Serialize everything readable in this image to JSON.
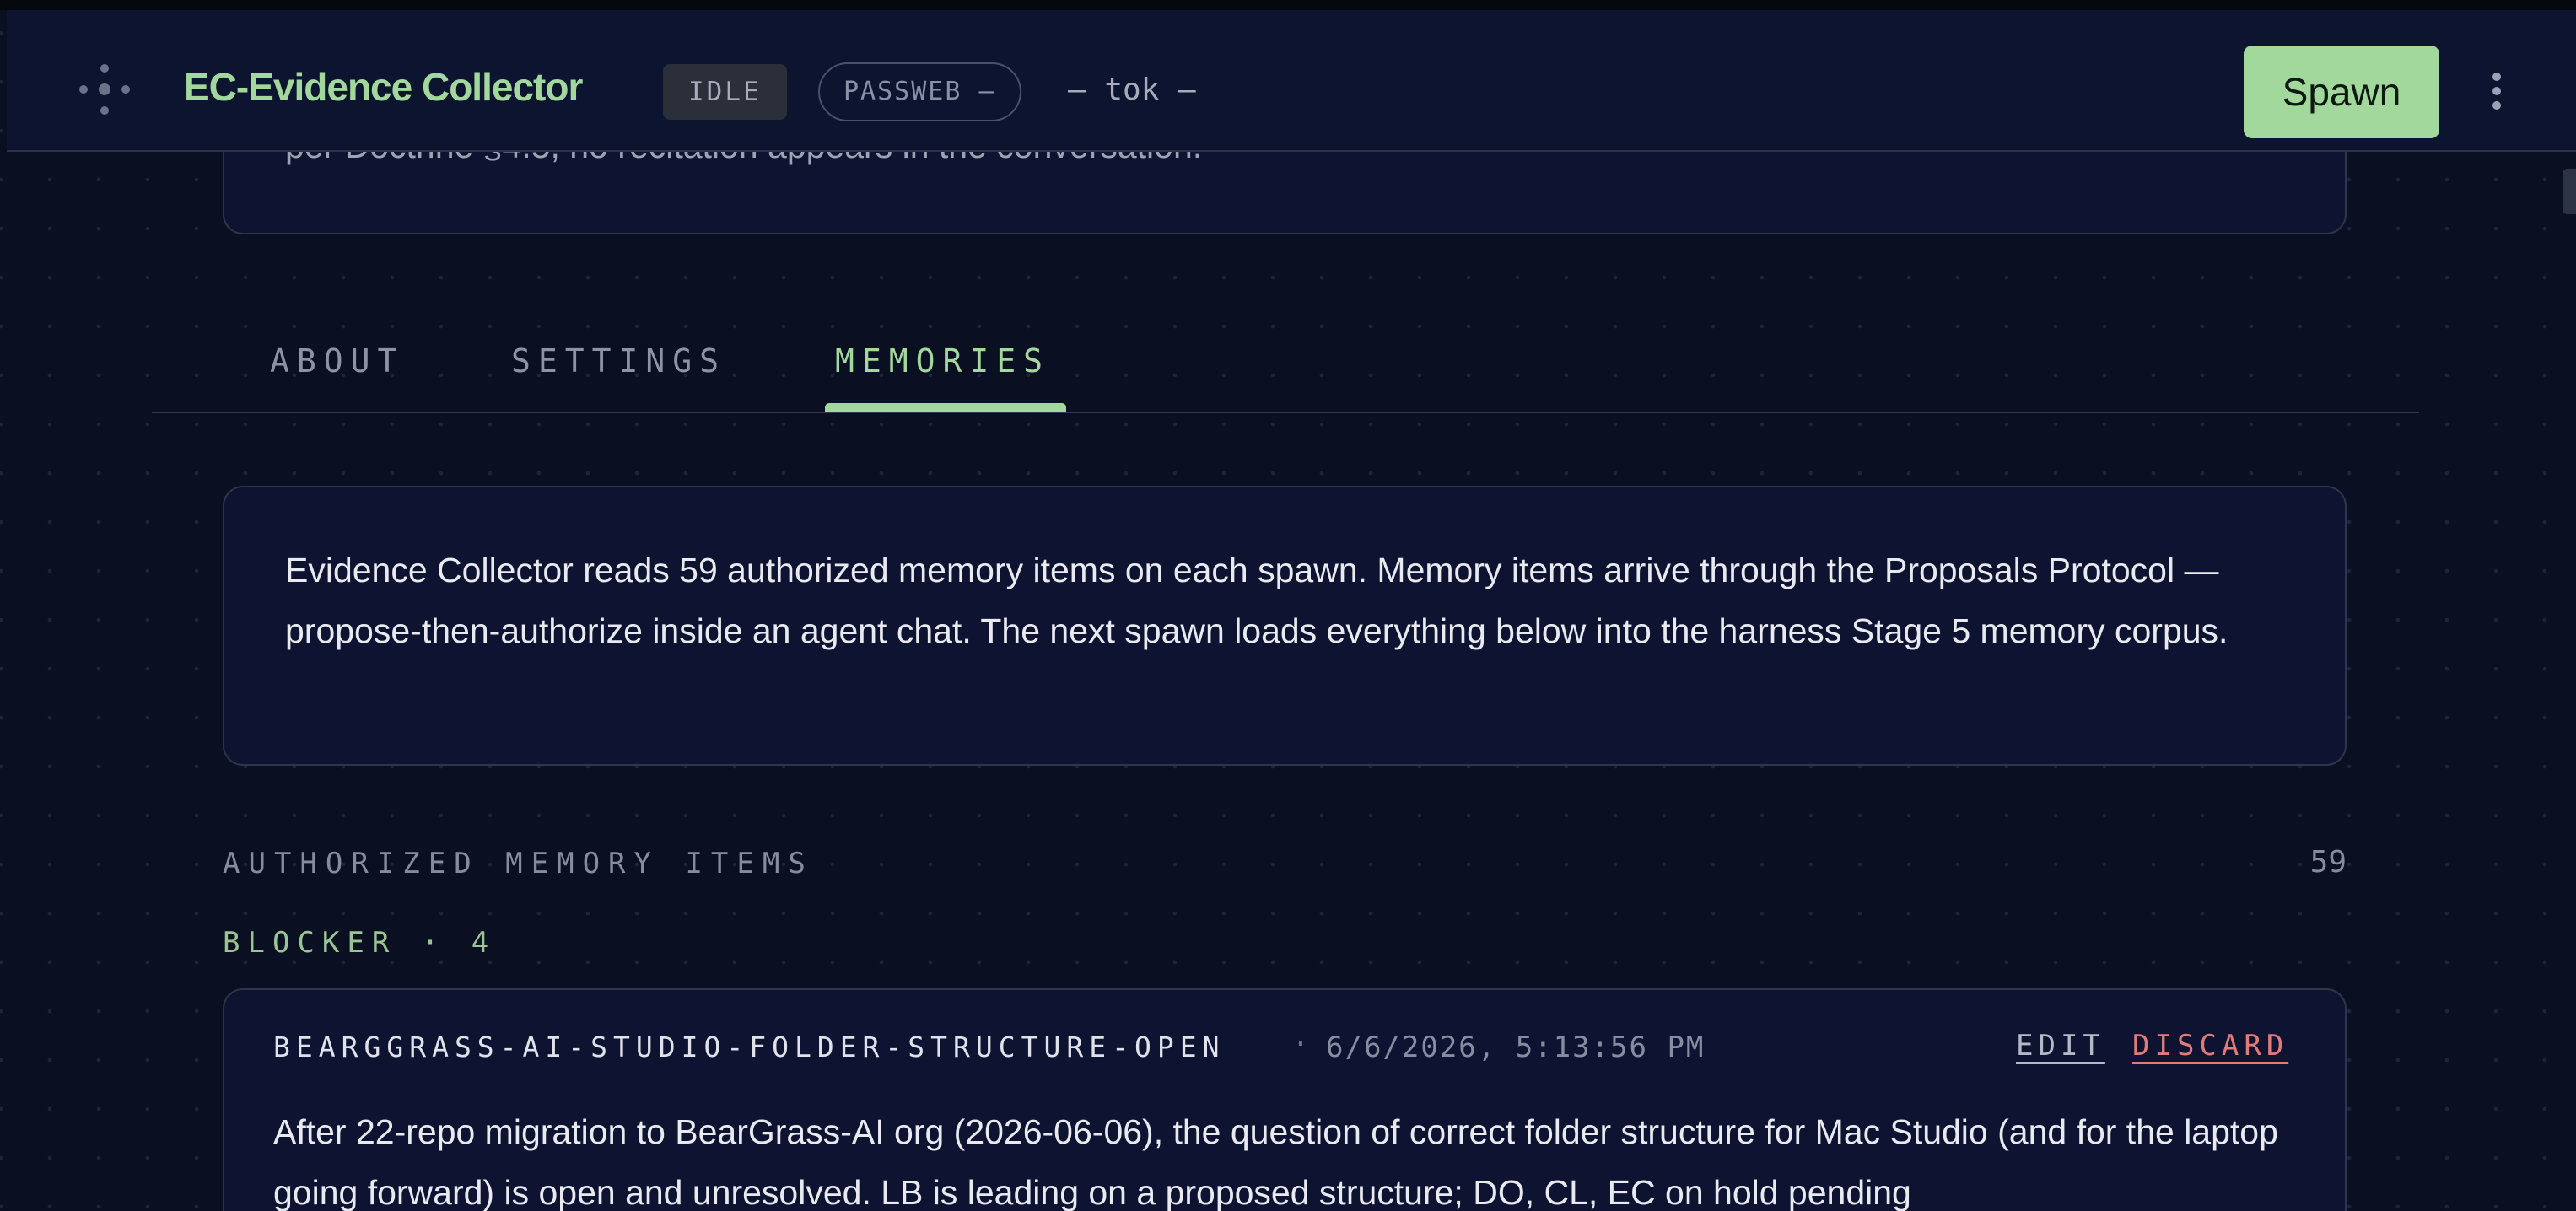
{
  "header": {
    "title": "EC-Evidence Collector",
    "status_badge": "IDLE",
    "passweb_badge": "PASSWEB —",
    "tok_readout": "— tok —",
    "spawn_label": "Spawn"
  },
  "previous_card": {
    "text_fragment": "per Doctrine §4.5, no recitation appears in the conversation."
  },
  "tabs": [
    {
      "label": "ABOUT",
      "active": false
    },
    {
      "label": "SETTINGS",
      "active": false
    },
    {
      "label": "MEMORIES",
      "active": true
    }
  ],
  "info": {
    "text": "Evidence Collector reads 59 authorized memory items on each spawn. Memory items arrive through the Proposals Protocol — propose-then-authorize inside an agent chat. The next spawn loads everything below into the harness Stage 5 memory corpus."
  },
  "memory_section": {
    "title": "AUTHORIZED MEMORY ITEMS",
    "count": "59",
    "group_label": "BLOCKER · 4",
    "items": [
      {
        "key": "BEARGGRASS-AI-STUDIO-FOLDER-STRUCTURE-OPEN",
        "separator": "·",
        "timestamp": "6/6/2026, 5:13:56 PM",
        "edit_label": "EDIT",
        "discard_label": "DISCARD",
        "body": "After 22-repo migration to BearGrass-AI org (2026-06-06), the question of correct folder structure for Mac Studio (and for the laptop going forward) is open and unresolved. LB is leading on a proposed structure; DO, CL, EC on hold pending"
      }
    ]
  },
  "colors": {
    "accent_green": "#a3d89c",
    "discard_red": "#e07b7b",
    "background": "#0a0f22",
    "card": "#0d1330"
  }
}
